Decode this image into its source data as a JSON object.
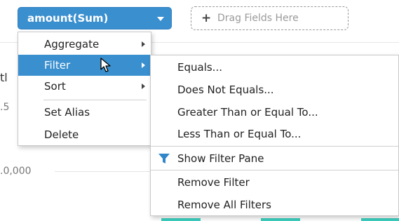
{
  "field_pill": {
    "label": "amount(Sum)",
    "icon": "chevron-down-icon"
  },
  "drop_zone": {
    "plus": "+",
    "text": "Drag Fields Here"
  },
  "background_axis": {
    "tick_partial_1": ".5",
    "tick_partial_2": ".0,000",
    "title_partial": "tl"
  },
  "context_menu": {
    "items": [
      {
        "label": "Aggregate",
        "has_submenu": true
      },
      {
        "label": "Filter",
        "has_submenu": true,
        "active": true
      },
      {
        "label": "Sort",
        "has_submenu": true
      },
      {
        "label": "Set Alias",
        "has_submenu": false
      },
      {
        "label": "Delete",
        "has_submenu": false
      }
    ]
  },
  "filter_submenu": {
    "conditions": [
      "Equals...",
      "Does Not Equals...",
      "Greater Than or Equal To...",
      "Less Than or Equal To..."
    ],
    "show_filter_pane": "Show Filter Pane",
    "show_filter_pane_icon": "funnel-icon",
    "remove_filter": "Remove Filter",
    "remove_all_filters": "Remove All Filters"
  },
  "colors": {
    "accent": "#3a8fcf",
    "bar": "#3ccfbf",
    "border": "#c8c8c8"
  }
}
